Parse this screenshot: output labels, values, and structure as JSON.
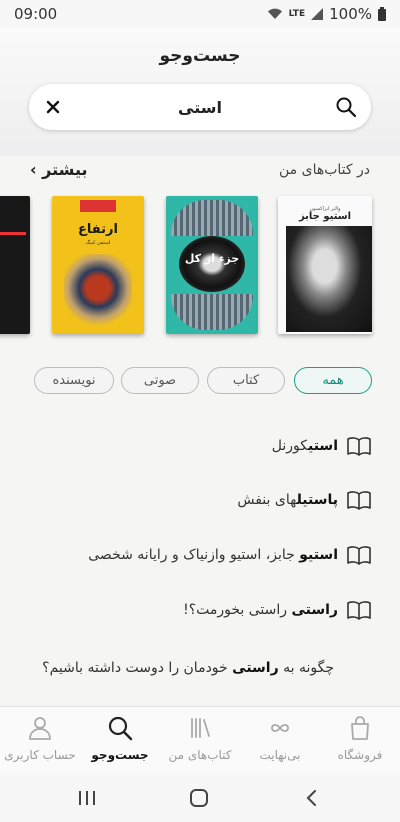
{
  "status_bar": {
    "time": "09:00",
    "network": "LTE",
    "battery": "100%"
  },
  "page": {
    "title": "جست‌وجو"
  },
  "search": {
    "value": "استی"
  },
  "library": {
    "title": "در کتاب‌های من",
    "more_label": "بیشتر"
  },
  "books": [
    {
      "title": "استیو جابز",
      "author": "والتر ایزاکسون"
    },
    {
      "title": "جزء از کل",
      "subtitle": ""
    },
    {
      "title": "ارتفاع",
      "author": "استفن کینگ"
    }
  ],
  "filters": [
    {
      "label": "همه",
      "selected": true
    },
    {
      "label": "کتاب",
      "selected": false
    },
    {
      "label": "صوتی",
      "selected": false
    },
    {
      "label": "نویسنده",
      "selected": false
    }
  ],
  "suggestions": [
    {
      "bold": "استی",
      "rest": "کورنل "
    },
    {
      "bold": "پاستیل",
      "rest": "های بنفش"
    },
    {
      "bold": "استیو",
      "rest": " جابز، استیو وازنیاک و رایانه شخصی"
    },
    {
      "bold": "راستی",
      "rest": " راستی بخورمت؟!"
    },
    {
      "pre": "چگونه به ",
      "bold": "راستی",
      "rest": " خودمان را دوست داشته باشیم؟"
    }
  ],
  "bottom_nav": {
    "store": "فروشگاه",
    "unlimited": "بی‌نهایت",
    "my_books": "کتاب‌های من",
    "search": "جست‌وجو",
    "account": "حساب کاربری",
    "active": "search"
  },
  "colors": {
    "accent": "#1aa08a",
    "background": "#f5f5f3"
  }
}
